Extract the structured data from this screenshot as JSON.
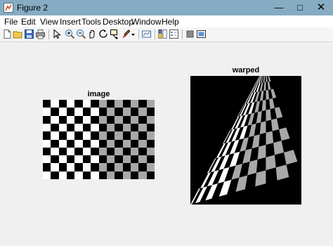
{
  "window": {
    "title": "Figure 2",
    "icon": "matlab-figure-icon",
    "controls": [
      "minimize-icon",
      "maximize-icon",
      "close-icon"
    ]
  },
  "menu": [
    "File",
    "Edit",
    "View",
    "Insert",
    "Tools",
    "Desktop",
    "Window",
    "Help"
  ],
  "toolbar": [
    "new-figure-icon",
    "open-icon",
    "save-icon",
    "print-icon",
    "pointer-icon",
    "zoom-in-icon",
    "zoom-out-icon",
    "pan-icon",
    "rotate-icon",
    "data-cursor-icon",
    "brush-icon",
    "brush-dropdown-icon",
    "link-plot-icon",
    "colorbar-icon",
    "legend-icon",
    "hide-plot-tools-icon",
    "show-plot-tools-icon"
  ],
  "axes": {
    "left_title": "image",
    "right_title": "warped"
  },
  "colors": {
    "titlebar": "#85acc2",
    "gray_square": "#a8a8a8",
    "black": "#000000",
    "white": "#ffffff"
  }
}
